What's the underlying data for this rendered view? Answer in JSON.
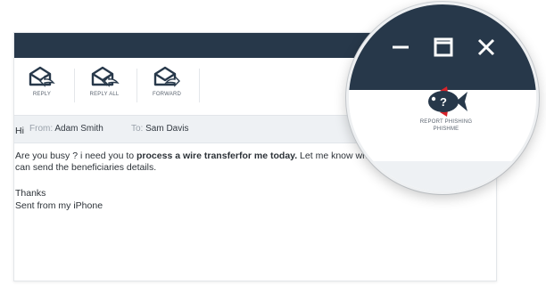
{
  "ribbon": {
    "buttons": [
      {
        "label": "REPLY",
        "icon": "reply-icon"
      },
      {
        "label": "REPLY ALL",
        "icon": "reply-all-icon"
      },
      {
        "label": "FORWARD",
        "icon": "forward-icon"
      }
    ]
  },
  "header": {
    "from_label": "From:",
    "from_value": "Adam Smith",
    "to_label": "To:",
    "to_value": "Sam Davis"
  },
  "message": {
    "greeting": "Hi",
    "line_pre": "Are you busy ? i need you to ",
    "line_bold": "process a wire transferfor me today.",
    "line_post": " Let me know when you are free so that i can send the beneficiaries details.",
    "thanks": "Thanks",
    "signature": "Sent from my iPhone"
  },
  "magnifier": {
    "window_controls": [
      "minimize-icon",
      "maximize-icon",
      "close-icon"
    ],
    "report_label_1": "REPORT PHISHING",
    "report_label_2": "PHISHME",
    "report_icon": "phish-fish-icon"
  },
  "colors": {
    "titlebar": "#27384a",
    "header_bg": "#eef1f4",
    "accent_red": "#d8232a"
  }
}
